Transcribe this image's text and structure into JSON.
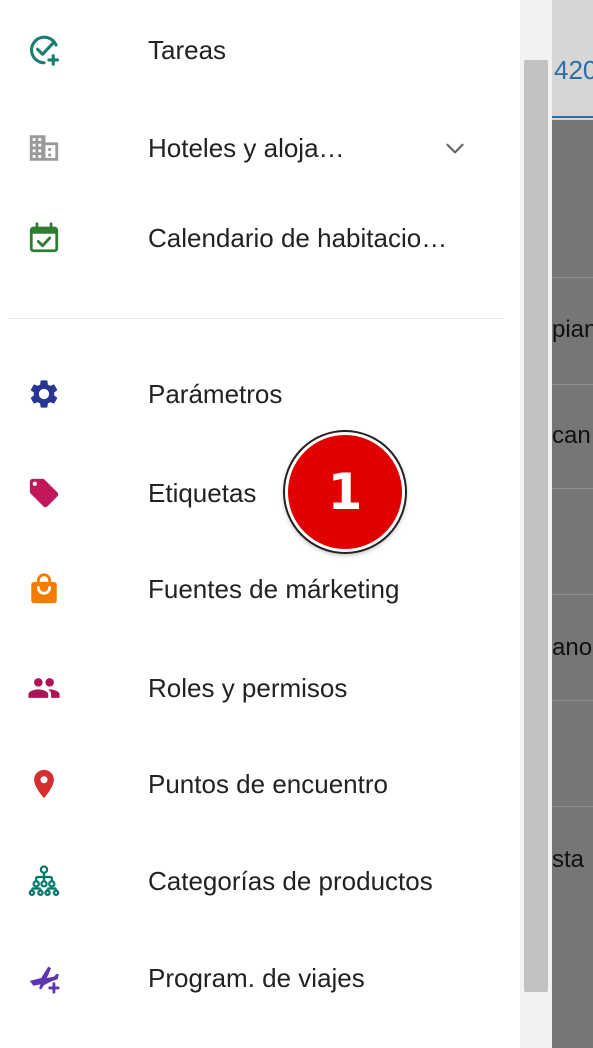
{
  "menu": {
    "items": [
      {
        "label": "Tareas",
        "icon": "tasks-check-icon",
        "color": "#1a7f72"
      },
      {
        "label": "Hoteles y aloja…",
        "icon": "building-icon",
        "color": "#8a8a8a",
        "expandable": true
      },
      {
        "label": "Calendario de habitacio…",
        "icon": "calendar-check-icon",
        "color": "#2e7d32"
      },
      {
        "label": "Parámetros",
        "icon": "gear-icon",
        "color": "#283593"
      },
      {
        "label": "Etiquetas",
        "icon": "tag-icon",
        "color": "#c2185b"
      },
      {
        "label": "Fuentes de márketing",
        "icon": "shopping-bag-icon",
        "color": "#f57c00"
      },
      {
        "label": "Roles y permisos",
        "icon": "people-icon",
        "color": "#ad1457"
      },
      {
        "label": "Puntos de encuentro",
        "icon": "location-pin-icon",
        "color": "#d32f2f"
      },
      {
        "label": "Categorías de productos",
        "icon": "hierarchy-icon",
        "color": "#00796b"
      },
      {
        "label": "Program. de viajes",
        "icon": "plane-plus-icon",
        "color": "#5e35b1"
      }
    ]
  },
  "background": {
    "top_text": "420",
    "rows": [
      "pian",
      "can",
      "ano",
      "sta"
    ]
  },
  "badge": {
    "label": "1",
    "color": "#e00000"
  }
}
